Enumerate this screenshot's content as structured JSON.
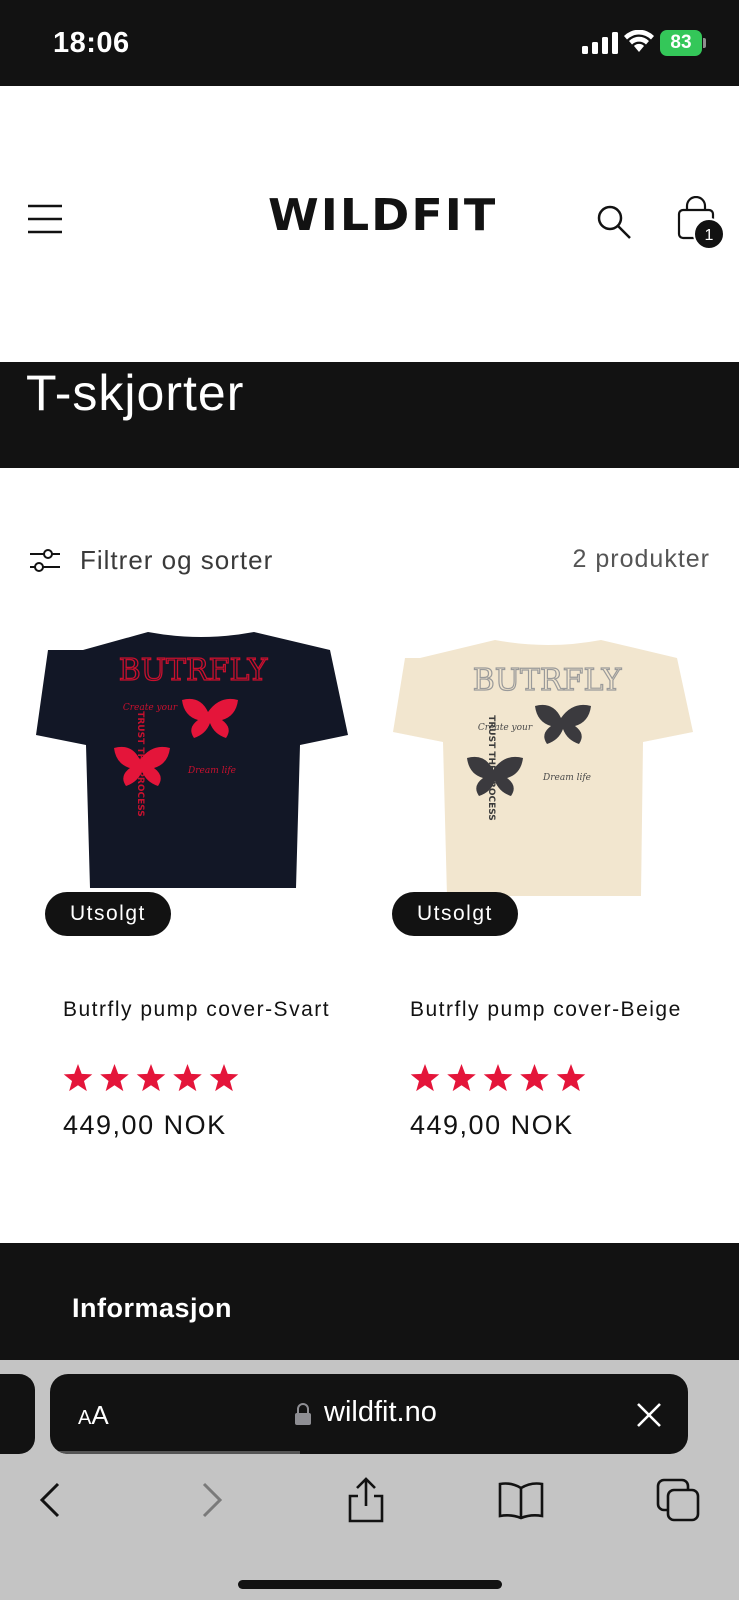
{
  "status_bar": {
    "time": "18:06",
    "battery": "83",
    "icons": [
      "cellular-signal-icon",
      "wifi-icon",
      "battery-charging-icon"
    ]
  },
  "header": {
    "logo": "WILDFIT",
    "cart_count": "1",
    "icons": [
      "hamburger-menu-icon",
      "search-icon",
      "shopping-bag-icon"
    ]
  },
  "collection": {
    "title": "T-skjorter"
  },
  "filter": {
    "label": "Filtrer og sorter",
    "count": "2 produkter"
  },
  "products": [
    {
      "title": "Butrfly pump cover-Svart",
      "badge": "Utsolgt",
      "price": "449,00 NOK",
      "rating": 5,
      "print_text": {
        "brand": "BUTRFLY",
        "side": "TRUST THE PROCESS",
        "left": "Create your",
        "right": "Dream life"
      }
    },
    {
      "title": "Butrfly pump cover-Beige",
      "badge": "Utsolgt",
      "price": "449,00 NOK",
      "rating": 5,
      "print_text": {
        "brand": "BUTRFLY",
        "side": "TRUST THE PROCESS",
        "left": "Create your",
        "right": "Dream life"
      }
    }
  ],
  "footer": {
    "heading": "Informasjon"
  },
  "browser": {
    "aa_label_small": "A",
    "aa_label_large": "A",
    "url": "wildfit.no"
  },
  "colors": {
    "dark": "#121212",
    "star": "#e4153a",
    "battery": "#34c759",
    "shirt_black": "#121726",
    "shirt_beige": "#f2e6cf",
    "chrome_gray": "#c4c4c4"
  }
}
